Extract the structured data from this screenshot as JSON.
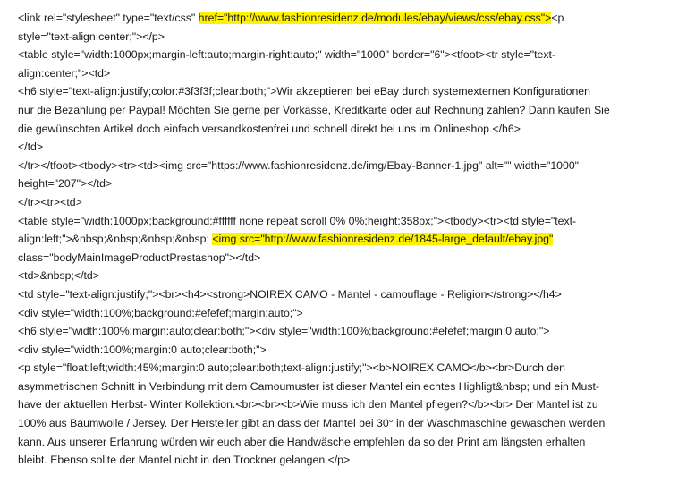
{
  "document": {
    "lines": [
      {
        "pre": "<link rel=\"stylesheet\" type=\"text/css\" ",
        "hl": "href=\"http://www.fashionresidenz.de/modules/ebay/views/css/ebay.css\">",
        "post": "<p"
      },
      {
        "pre": "style=\"text-align:center;\"></p>"
      },
      {
        "pre": "<table style=\"width:1000px;margin-left:auto;margin-right:auto;\" width=\"1000\" border=\"6\"><tfoot><tr style=\"text-"
      },
      {
        "pre": "align:center;\"><td>"
      },
      {
        "pre": "<h6 style=\"text-align:justify;color:#3f3f3f;clear:both;\">Wir akzeptieren bei eBay durch systemexternen Konfigurationen"
      },
      {
        "pre": "nur die Bezahlung per Paypal! Möchten Sie gerne per Vorkasse, Kreditkarte oder auf Rechnung zahlen? Dann kaufen Sie"
      },
      {
        "pre": "die gewünschten Artikel doch einfach versandkostenfrei und schnell direkt bei uns im Onlineshop.</h6>"
      },
      {
        "pre": "</td>"
      },
      {
        "pre": "</tr></tfoot><tbody><tr><td><img src=\"https://www.fashionresidenz.de/img/Ebay-Banner-1.jpg\" alt=\"\" width=\"1000\""
      },
      {
        "pre": "height=\"207\"></td>"
      },
      {
        "pre": "</tr><tr><td>"
      },
      {
        "pre": "<table style=\"width:1000px;background:#ffffff none repeat scroll 0% 0%;height:358px;\"><tbody><tr><td style=\"text-"
      },
      {
        "pre": "align:left;\">&nbsp;&nbsp;&nbsp;&nbsp; ",
        "hl": "<img src=\"http://www.fashionresidenz.de/1845-large_default/ebay.jpg\""
      },
      {
        "pre": "class=\"bodyMainImageProductPrestashop\"></td>"
      },
      {
        "pre": "<td>&nbsp;</td>"
      },
      {
        "pre": "<td style=\"text-align:justify;\"><br><h4><strong>NOIREX CAMO - Mantel - camouflage - Religion</strong></h4>"
      },
      {
        "pre": "<div style=\"width:100%;background:#efefef;margin:auto;\">"
      },
      {
        "pre": "<h6 style=\"width:100%;margin:auto;clear:both;\"><div style=\"width:100%;background:#efefef;margin:0 auto;\">"
      },
      {
        "pre": "<div style=\"width:100%;margin:0 auto;clear:both;\">"
      },
      {
        "pre": "<p style=\"float:left;width:45%;margin:0 auto;clear:both;text-align:justify;\"><b>NOIREX CAMO</b><br>Durch den"
      },
      {
        "pre": "asymmetrischen Schnitt in Verbindung mit dem Camoumuster ist dieser Mantel ein echtes Highligt&nbsp; und ein Must-"
      },
      {
        "pre": "have der aktuellen Herbst- Winter Kollektion.<br><br><b>Wie muss ich den Mantel pflegen?</b><br> Der Mantel ist zu"
      },
      {
        "pre": "100% aus Baumwolle / Jersey. Der Hersteller gibt an dass der Mantel bei 30° in der Waschmaschine gewaschen werden"
      },
      {
        "pre": "kann. Aus unserer Erfahrung würden wir euch aber die Handwäsche empfehlen da so der Print am längsten erhalten"
      },
      {
        "pre": "bleibt. Ebenso sollte der Mantel nicht in den Trockner gelangen.</p>"
      }
    ],
    "highlight_color": "#fff200"
  }
}
